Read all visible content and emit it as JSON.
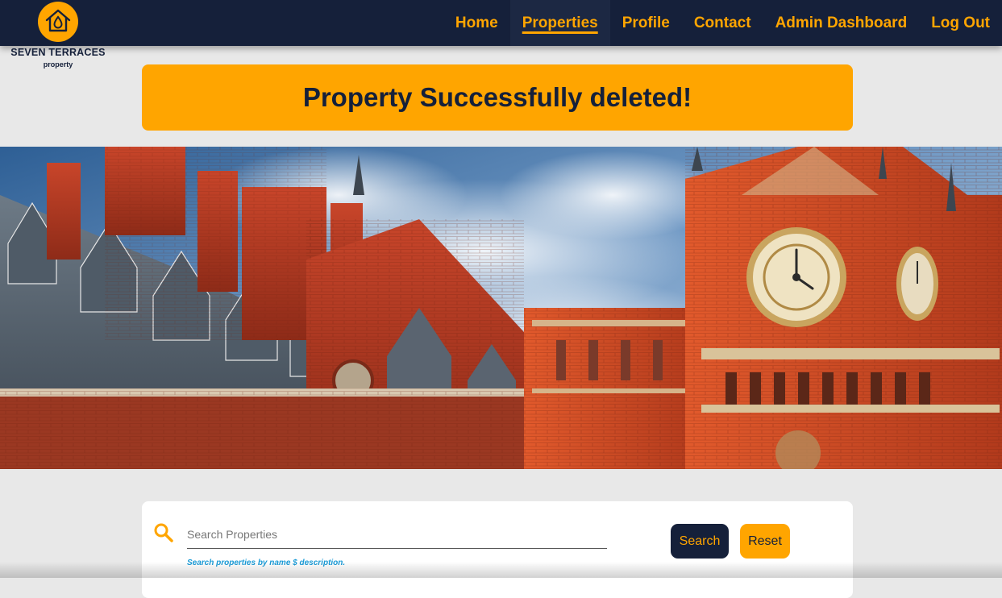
{
  "brand": {
    "name": "SEVEN TERRACES",
    "tagline": "property",
    "icon": "house-drop-icon",
    "colors": {
      "navy": "#15203a",
      "orange": "#ffa500",
      "hint_blue": "#1a9bd7",
      "page_bg": "#e8e8e8"
    }
  },
  "nav": {
    "items": [
      {
        "label": "Home"
      },
      {
        "label": "Properties",
        "active": true
      },
      {
        "label": "Profile"
      },
      {
        "label": "Contact"
      },
      {
        "label": "Admin Dashboard"
      },
      {
        "label": "Log Out"
      }
    ]
  },
  "alert": {
    "message": "Property Successfully deleted!"
  },
  "hero": {
    "image": "gothic-red-brick-building-with-clock-tower"
  },
  "search": {
    "icon": "search-icon",
    "placeholder": "Search Properties",
    "value": "",
    "hint": "Search properties by name $ description.",
    "search_label": "Search",
    "reset_label": "Reset"
  }
}
